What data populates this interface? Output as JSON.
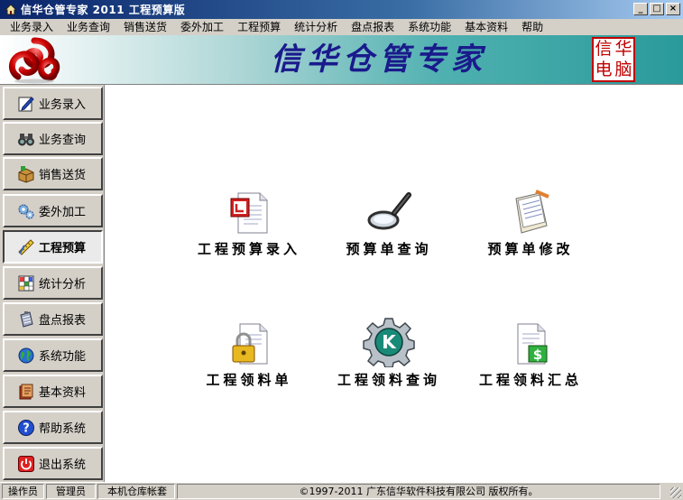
{
  "window": {
    "title": "信华仓管专家 2011 工程预算版",
    "min": "_",
    "max": "□",
    "close": "×"
  },
  "menu": [
    "业务录入",
    "业务查询",
    "销售送货",
    "委外加工",
    "工程预算",
    "统计分析",
    "盘点报表",
    "系统功能",
    "基本资料",
    "帮助"
  ],
  "banner": {
    "title": "信华仓管专家",
    "seal": [
      "信",
      "华",
      "电",
      "脑"
    ]
  },
  "sidebar": [
    {
      "label": "业务录入",
      "icon": "pencil-icon"
    },
    {
      "label": "业务查询",
      "icon": "binoculars-icon"
    },
    {
      "label": "销售送货",
      "icon": "box-icon"
    },
    {
      "label": "委外加工",
      "icon": "gears-icon"
    },
    {
      "label": "工程预算",
      "icon": "ruler-icon",
      "active": true
    },
    {
      "label": "统计分析",
      "icon": "grid-icon"
    },
    {
      "label": "盘点报表",
      "icon": "clipboard-icon"
    },
    {
      "label": "系统功能",
      "icon": "globe-icon"
    },
    {
      "label": "基本资料",
      "icon": "book-icon"
    },
    {
      "label": "帮助系统",
      "icon": "help-icon"
    },
    {
      "label": "退出系统",
      "icon": "power-icon"
    }
  ],
  "tiles": [
    {
      "label": "工程预算录入",
      "icon": "document-icon"
    },
    {
      "label": "预算单查询",
      "icon": "magnifier-icon"
    },
    {
      "label": "预算单修改",
      "icon": "notepad-icon"
    },
    {
      "label": "工程领料单",
      "icon": "locked-document-icon"
    },
    {
      "label": "工程领料查询",
      "icon": "k-gear-icon"
    },
    {
      "label": "工程领料汇总",
      "icon": "dollar-document-icon"
    }
  ],
  "status": {
    "operator_label": "操作员",
    "operator": "管理员",
    "account": "本机仓库帐套",
    "copyright": "©1997-2011   广东信华软件科技有限公司   版权所有。"
  },
  "colors": {
    "banner_title": "#1a1a8c",
    "seal": "#c00000",
    "titlebar": "#0a246a"
  }
}
